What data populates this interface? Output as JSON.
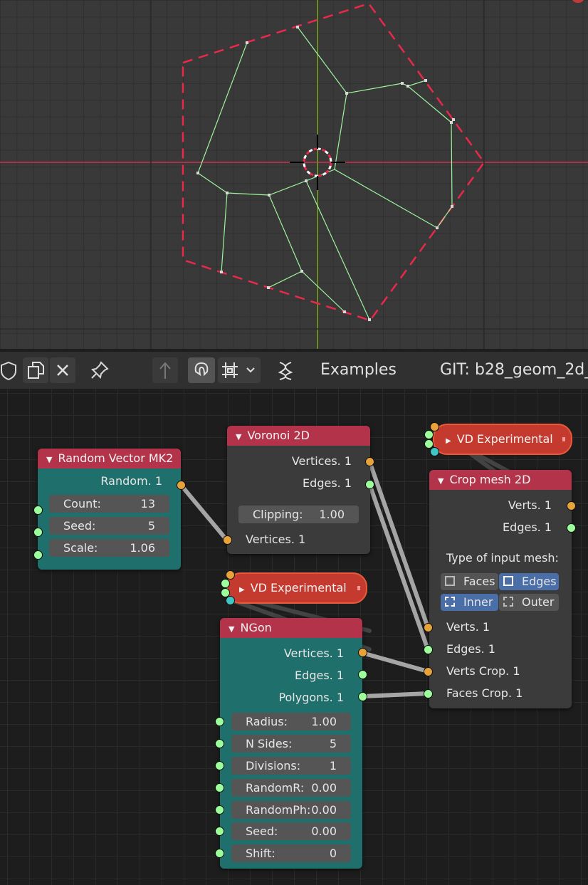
{
  "header": {
    "tree_name": "Examples",
    "git_label": "GIT: b28_geom_2d_"
  },
  "nodes": {
    "random_vector": {
      "title": "Random Vector MK2",
      "output": "Random. 1",
      "fields": [
        {
          "label": "Count:",
          "value": "13"
        },
        {
          "label": "Seed:",
          "value": "5"
        },
        {
          "label": "Scale:",
          "value": "1.06"
        }
      ]
    },
    "voronoi": {
      "title": "Voronoi 2D",
      "outputs": [
        "Vertices. 1",
        "Edges. 1"
      ],
      "clipping": {
        "label": "Clipping:",
        "value": "1.00"
      },
      "input": "Vertices. 1"
    },
    "vd_top": {
      "title": "VD Experimental"
    },
    "vd_mid": {
      "title": "VD Experimental"
    },
    "crop": {
      "title": "Crop mesh 2D",
      "outputs": [
        "Verts. 1",
        "Edges. 1"
      ],
      "mode_label": "Type of input mesh:",
      "mode_buttons": [
        {
          "label": "Faces",
          "active": false
        },
        {
          "label": "Edges",
          "active": true
        },
        {
          "label": "Inner",
          "active": true
        },
        {
          "label": "Outer",
          "active": false
        }
      ],
      "inputs": [
        "Verts. 1",
        "Edges. 1",
        "Verts Crop. 1",
        "Faces Crop. 1"
      ]
    },
    "ngon": {
      "title": "NGon",
      "outputs": [
        "Vertices. 1",
        "Edges. 1",
        "Polygons. 1"
      ],
      "fields": [
        {
          "label": "Radius:",
          "value": "1.00"
        },
        {
          "label": "N Sides:",
          "value": "5"
        },
        {
          "label": "Divisions:",
          "value": "1"
        },
        {
          "label": "RandomR:",
          "value": "0.00"
        },
        {
          "label": "RandomPh:",
          "value": "0.00"
        },
        {
          "label": "Seed:",
          "value": "0.00"
        },
        {
          "label": "Shift:",
          "value": "0"
        }
      ]
    }
  },
  "colors": {
    "node_header": "#b3344a",
    "node_teal": "#1f6f6c",
    "node_gray": "#3b3b3b",
    "socket_vertices": "#e8a23a",
    "socket_edges": "#9cff9c",
    "mesh_wire": "#9ef59e",
    "crop_outline": "#e8294a",
    "active_button": "#4a6fa8"
  }
}
